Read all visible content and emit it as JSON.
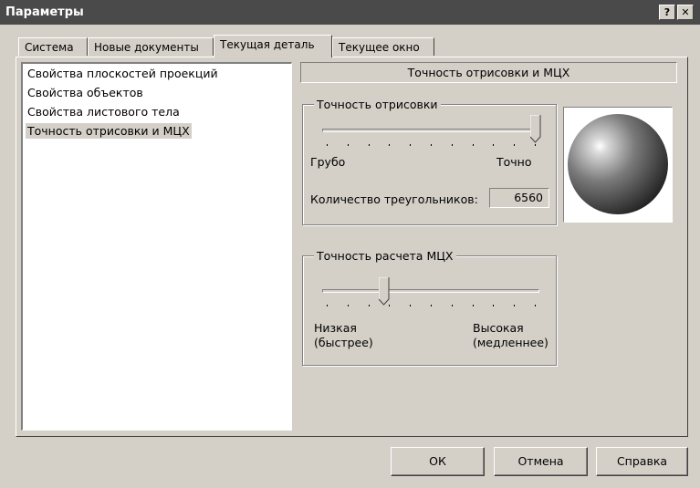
{
  "window": {
    "title": "Параметры",
    "help_button": "?",
    "close_button": "✕"
  },
  "tabs": [
    {
      "label": "Система",
      "active": false
    },
    {
      "label": "Новые документы",
      "active": false
    },
    {
      "label": "Текущая деталь",
      "active": true
    },
    {
      "label": "Текущее окно",
      "active": false
    }
  ],
  "tree": {
    "items": [
      {
        "label": "Свойства плоскостей проекций"
      },
      {
        "label": "Свойства объектов"
      },
      {
        "label": "Свойства листового тела"
      },
      {
        "label": "Точность отрисовки и МЦХ",
        "selected": true
      }
    ]
  },
  "panel": {
    "header": "Точность отрисовки и МЦХ",
    "render_precision": {
      "legend": "Точность отрисовки",
      "min_label": "Грубо",
      "max_label": "Точно",
      "level": 1.0,
      "triangles_label": "Количество треугольников:",
      "triangles_value": "6560"
    },
    "mch_precision": {
      "legend": "Точность расчета МЦХ",
      "min_label_line1": "Низкая",
      "min_label_line2": "(быстрее)",
      "max_label_line1": "Высокая",
      "max_label_line2": "(медленнее)",
      "level": 0.27
    }
  },
  "buttons": {
    "ok": "ОК",
    "cancel": "Отмена",
    "help": "Справка"
  }
}
